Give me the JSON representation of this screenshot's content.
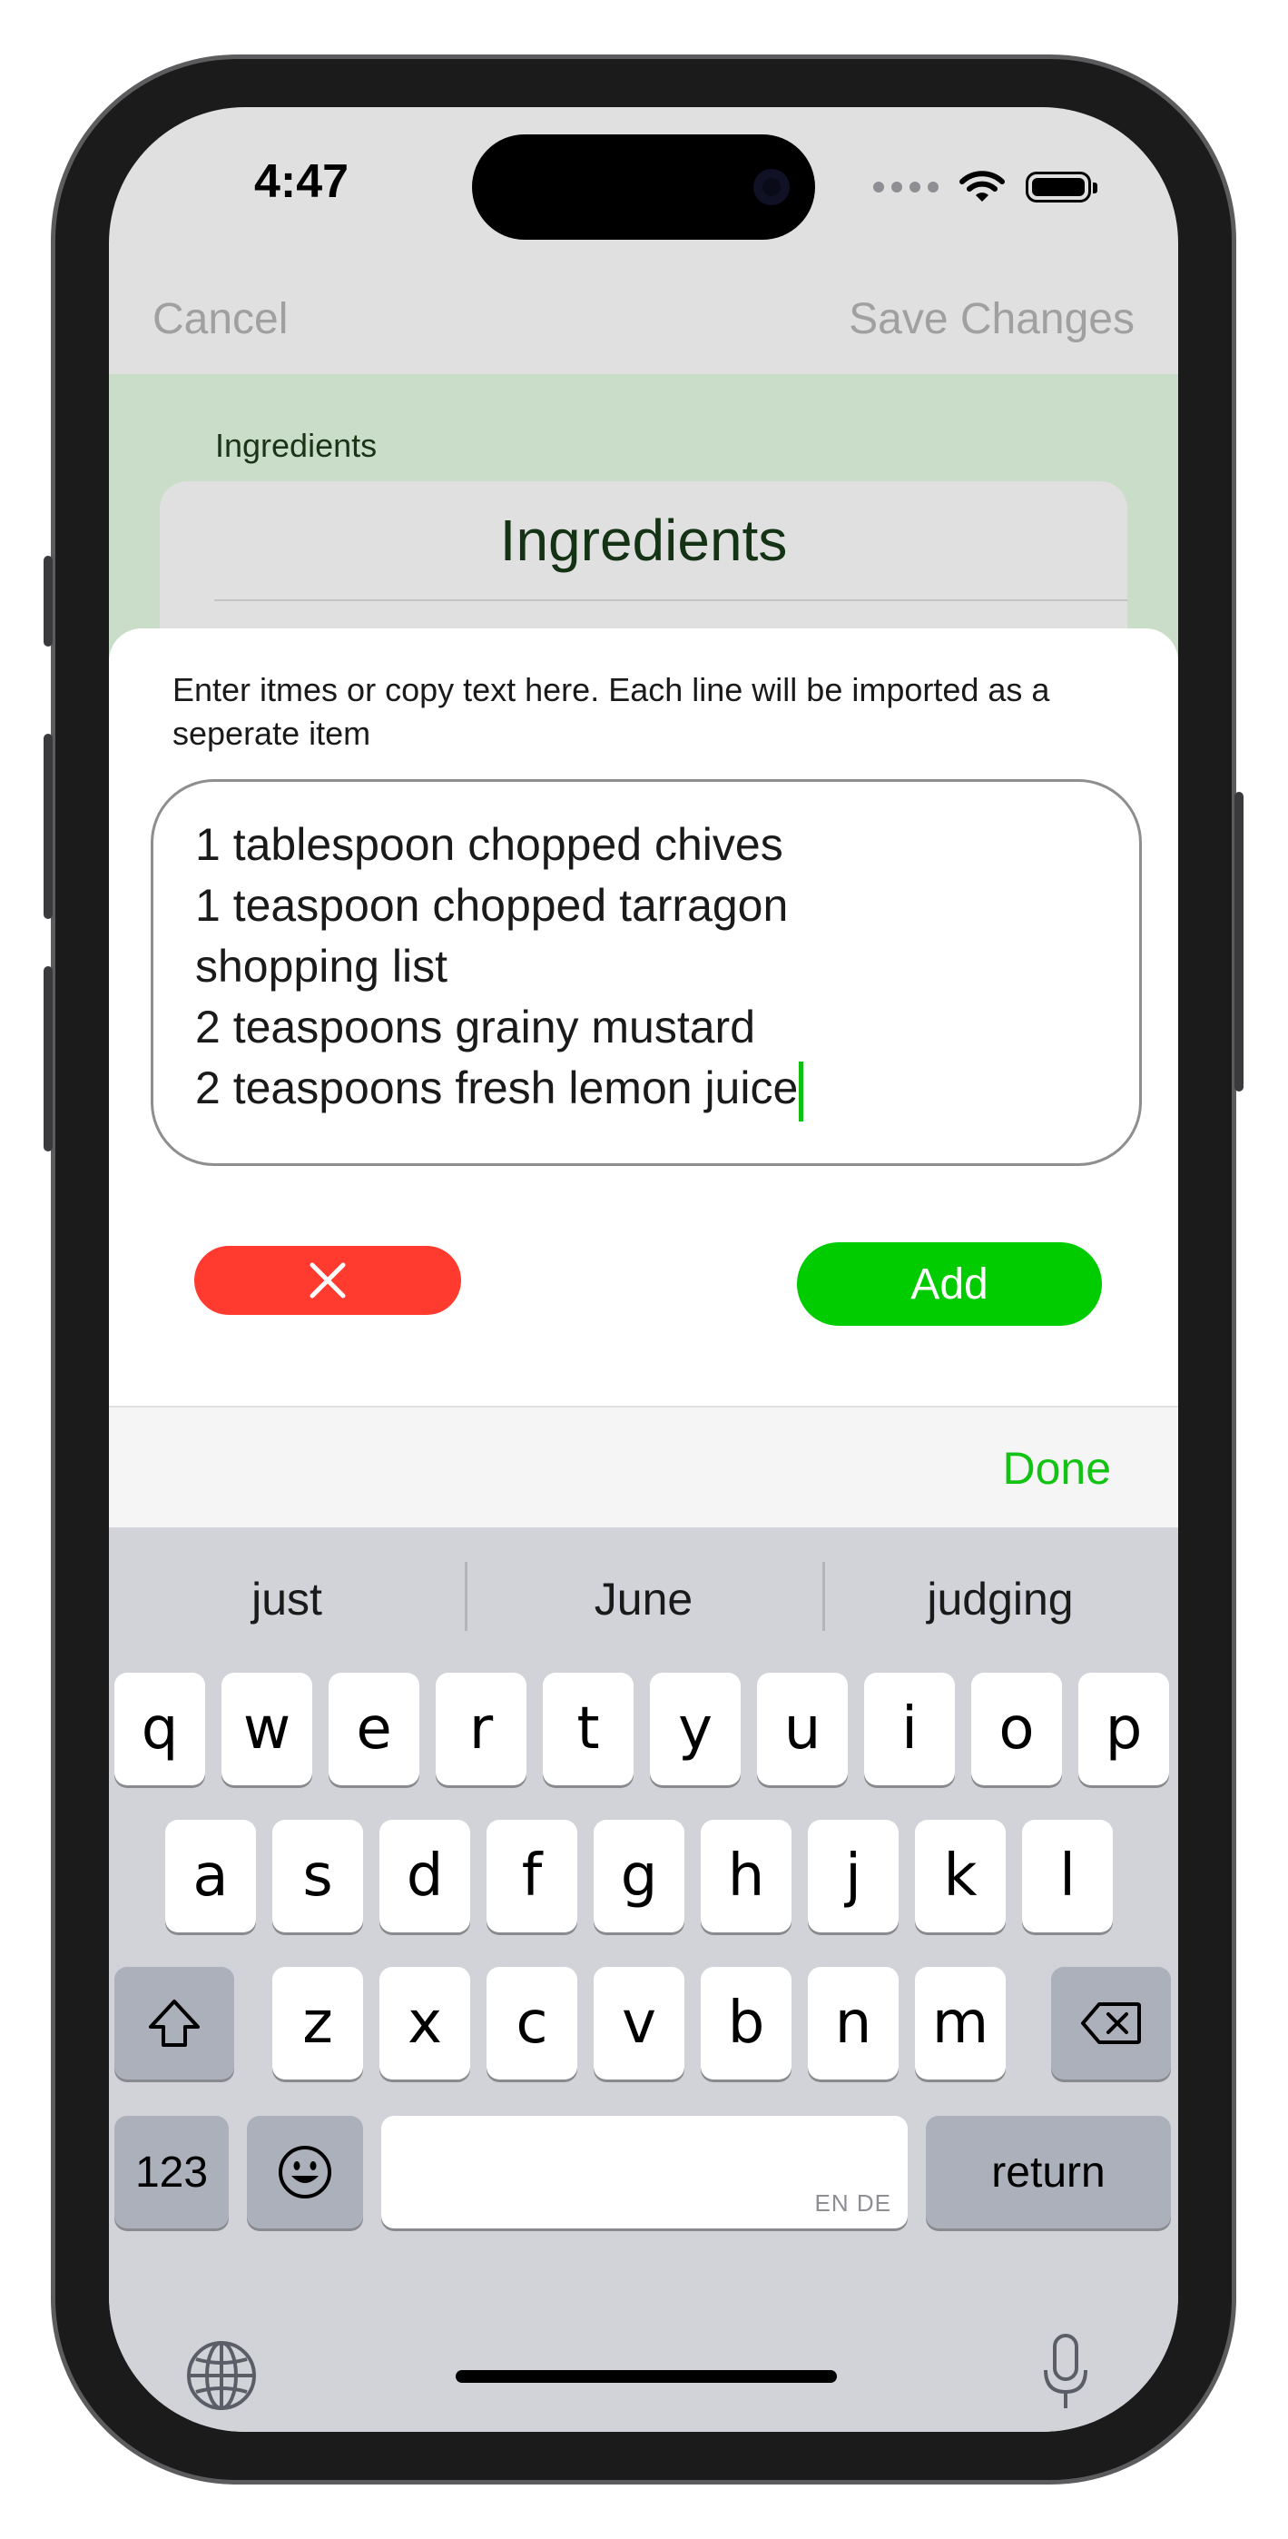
{
  "status": {
    "time": "4:47"
  },
  "nav": {
    "cancel": "Cancel",
    "save": "Save Changes"
  },
  "section": {
    "label": "Ingredients",
    "card_title": "Ingredients"
  },
  "sheet": {
    "instructions": "Enter itmes or copy text here. Each line will be imported as a seperate item",
    "text_lines": [
      "1 tablespoon chopped chives",
      "1 teaspoon chopped tarragon",
      "shopping list",
      "2 teaspoons grainy mustard",
      "2 teaspoons fresh lemon juice"
    ],
    "add_label": "Add",
    "cancel_icon": "x-icon"
  },
  "toolbar": {
    "done": "Done"
  },
  "keyboard": {
    "suggestions": [
      "just",
      "June",
      "judging"
    ],
    "row1": [
      "q",
      "w",
      "e",
      "r",
      "t",
      "y",
      "u",
      "i",
      "o",
      "p"
    ],
    "row2": [
      "a",
      "s",
      "d",
      "f",
      "g",
      "h",
      "j",
      "k",
      "l"
    ],
    "row3": [
      "z",
      "x",
      "c",
      "v",
      "b",
      "n",
      "m"
    ],
    "numbers_key": "123",
    "return_key": "return",
    "space_hint": "EN DE",
    "icons": [
      "shift-icon",
      "delete-icon",
      "emoji-icon",
      "globe-icon",
      "microphone-icon"
    ]
  },
  "colors": {
    "accent_green": "#00cc00",
    "danger_red": "#ff3b30",
    "section_bg": "#c9ddc8"
  }
}
